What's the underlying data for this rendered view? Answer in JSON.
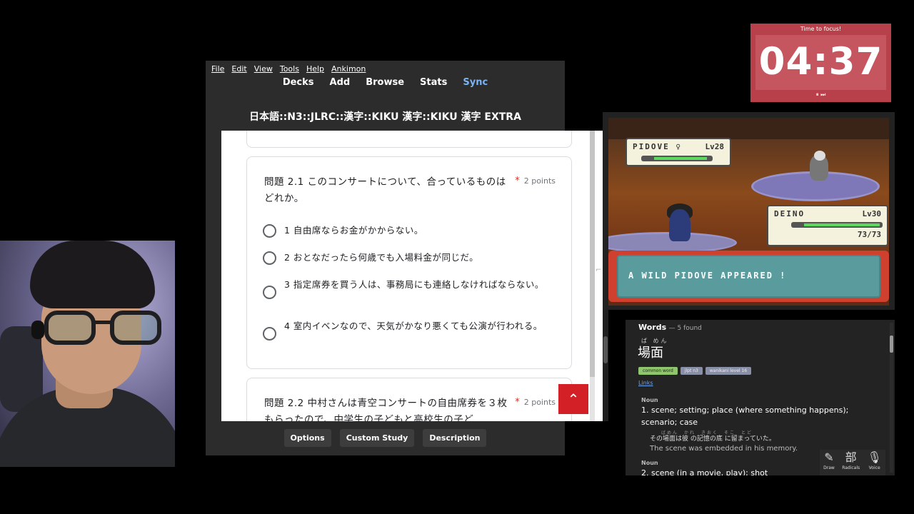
{
  "anki": {
    "menu": [
      "File",
      "Edit",
      "View",
      "Tools",
      "Help",
      "Ankimon"
    ],
    "toolbar": [
      "Decks",
      "Add",
      "Browse",
      "Stats",
      "Sync"
    ],
    "deck_title": "日本語::N3::JLRC::漢字::KIKU 漢字::KIKU 漢字 EXTRA",
    "question1": {
      "text": "問題 2.1 このコンサートについて、合っているものはどれか。",
      "points": "2 points",
      "options": [
        "1 自由席ならお金がかからない。",
        "2 おとなだったら何歳でも入場料金が同じだ。",
        "3 指定席券を買う人は、事務局にも連絡しなければならない。",
        "4 室内イベンなので、天気がかなり悪くても公演が行われる。"
      ]
    },
    "question2": {
      "text": "問題 2.2 中村さんは青空コンサートの自由席券を３枚もらったので、中学生の子どもと高校生の子ど",
      "points": "2 points"
    },
    "scroll_top_icon": "chevron-up-icon",
    "bottom_buttons": [
      "Options",
      "Custom Study",
      "Description"
    ]
  },
  "timer": {
    "label": "Time to focus!",
    "time": "04:37",
    "controls": "⏸ ⏭",
    "color": "#b8404a"
  },
  "game": {
    "enemy": {
      "name": "PIDOVE ♀",
      "level": "Lv28",
      "hp": 0.95
    },
    "player": {
      "name": "DEINO",
      "level": "Lv30",
      "hp_text": "73/73",
      "hp": 1.0
    },
    "message": "A WILD PIDOVE APPEARED !"
  },
  "dictionary": {
    "title": "Words",
    "found": "— 5 found",
    "reading": "ば めん",
    "headword": "場面",
    "tags": [
      "common word",
      "jlpt n3",
      "wanikani level 16"
    ],
    "links": "Links",
    "pos1": "Noun",
    "sense1": "1. scene; setting; place (where something happens); scenario; case",
    "example_furigana": "ばめん　かれ　きおく　そこ　とど",
    "example_jp": "その場面は彼 の記憶の底 に留まっていた。",
    "example_en": "The scene was embedded in his memory.",
    "pos2": "Noun",
    "sense2": "2. scene (in a movie, play); shot",
    "tools": [
      {
        "icon": "draw-icon",
        "glyph": "✎",
        "label": "Draw"
      },
      {
        "icon": "radicals-icon",
        "glyph": "部",
        "label": "Radicals"
      },
      {
        "icon": "microphone-icon",
        "glyph": "🎙",
        "label": "Voice"
      }
    ]
  }
}
